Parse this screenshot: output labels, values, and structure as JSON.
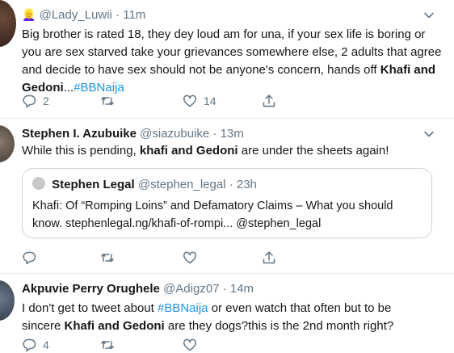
{
  "tweets": [
    {
      "emoji": "👱‍♀️",
      "name": "",
      "handle": "@Lady_Luwii",
      "time": "· 11m",
      "lines": [
        "Big brother is rated 18, they dey loud am for una, if your sex life is boring or",
        "you are sex starved take your grievances somewhere else, 2 adults that agree",
        "and decide to have sex should not be anyone's concern, hands off"
      ],
      "bold_1": "Khafi and",
      "bold_2": "Gedoni",
      "ellipsis": "...",
      "hashtag": "#BBNaija",
      "replies": "2",
      "retweets": "",
      "likes": "14"
    },
    {
      "name": "Stephen I. Azubuike",
      "handle": "@siazubuike",
      "time": "· 13m",
      "text_before": "While this is pending, ",
      "bold": "khafi and Gedoni",
      "text_after": " are under the sheets again!",
      "quote": {
        "name": "Stephen Legal",
        "handle": "@stephen_legal",
        "time": "· 23h",
        "line1": "Khafi: Of “Romping Loins” and Defamatory Claims – What you should",
        "line2": "know. stephenlegal.ng/khafi-of-rompi... @stephen_legal"
      },
      "replies": "",
      "retweets": "",
      "likes": ""
    },
    {
      "name": "Akpuvie Perry Orughele",
      "handle": "@Adigz07",
      "time": "· 14m",
      "l1_before": "I don't get to tweet about ",
      "l1_tag": "#BBNaija",
      "l1_after": "  or even watch that often but to be",
      "l2_before": "sincere ",
      "l2_bold": "Khafi and Gedoni",
      "l2_after": " are they dogs?this is the 2nd month right?",
      "replies": "4",
      "retweets": "",
      "likes": ""
    }
  ],
  "colors": {
    "text": "#14171a",
    "secondary": "#657786",
    "link": "#1b95e0",
    "border": "#e6ecf0"
  },
  "icons": [
    "chevron-down-icon",
    "reply-icon",
    "retweet-icon",
    "like-icon",
    "share-icon"
  ]
}
